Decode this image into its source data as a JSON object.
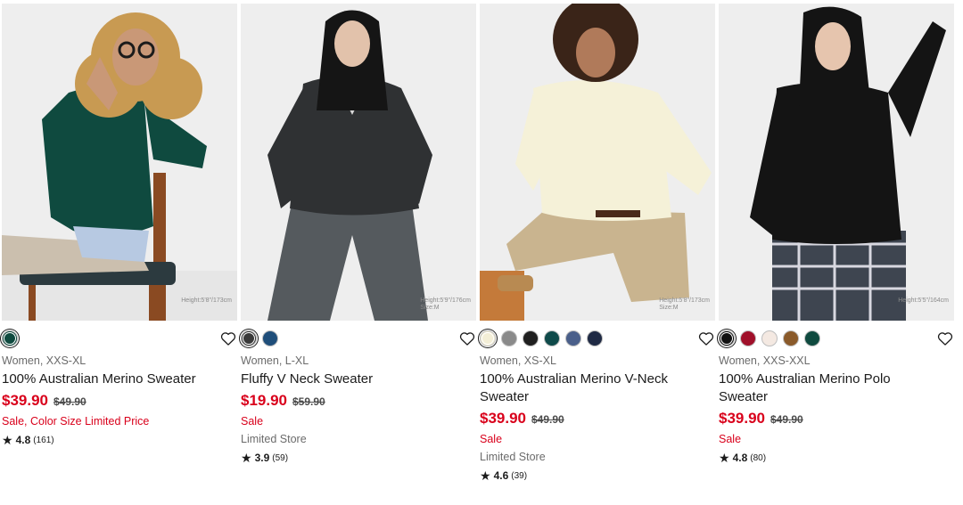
{
  "products": [
    {
      "height_note": [
        "Height:5'8\"/173cm",
        ""
      ],
      "swatches": [
        "#0f4a3f"
      ],
      "selected_swatch": 0,
      "meta": "Women, XXS-XL",
      "name_line1": "100% Australian Merino Sweater",
      "name_line2": "",
      "price": "$39.90",
      "original_price": "$49.90",
      "sale_text": "Sale, Color Size Limited Price",
      "store_text": "",
      "rating": "4.8",
      "reviews": "(161)"
    },
    {
      "height_note": [
        "Height:5'9\"/176cm",
        "Size:M"
      ],
      "swatches": [
        "#3a3a3a",
        "#1f4e7a"
      ],
      "selected_swatch": 0,
      "meta": "Women, L-XL",
      "name_line1": "Fluffy V Neck Sweater",
      "name_line2": "",
      "price": "$19.90",
      "original_price": "$59.90",
      "sale_text": "Sale",
      "store_text": "Limited Store",
      "rating": "3.9",
      "reviews": "(59)"
    },
    {
      "height_note": [
        "Height:5'8\"/173cm",
        "Size:M"
      ],
      "swatches": [
        "#f3eed6",
        "#8a8a8a",
        "#1f1f1f",
        "#0f4a4a",
        "#4a5f8a",
        "#1f2a44"
      ],
      "selected_swatch": 0,
      "meta": "Women, XS-XL",
      "name_line1": "100% Australian Merino V-Neck",
      "name_line2": "Sweater",
      "price": "$39.90",
      "original_price": "$49.90",
      "sale_text": "Sale",
      "store_text": "Limited Store",
      "rating": "4.6",
      "reviews": "(39)"
    },
    {
      "height_note": [
        "Height:5'5\"/164cm",
        ""
      ],
      "swatches": [
        "#111111",
        "#a0102a",
        "#f4e9e2",
        "#8a5a2a",
        "#0f4a3f"
      ],
      "selected_swatch": 0,
      "meta": "Women, XXS-XXL",
      "name_line1": "100% Australian Merino Polo",
      "name_line2": "Sweater",
      "price": "$39.90",
      "original_price": "$49.90",
      "sale_text": "Sale",
      "store_text": "",
      "rating": "4.8",
      "reviews": "(80)"
    }
  ],
  "icons": {
    "favorite": "heart-outline-icon",
    "rating": "star-icon"
  },
  "colors": {
    "sale_red": "#d9001b"
  }
}
